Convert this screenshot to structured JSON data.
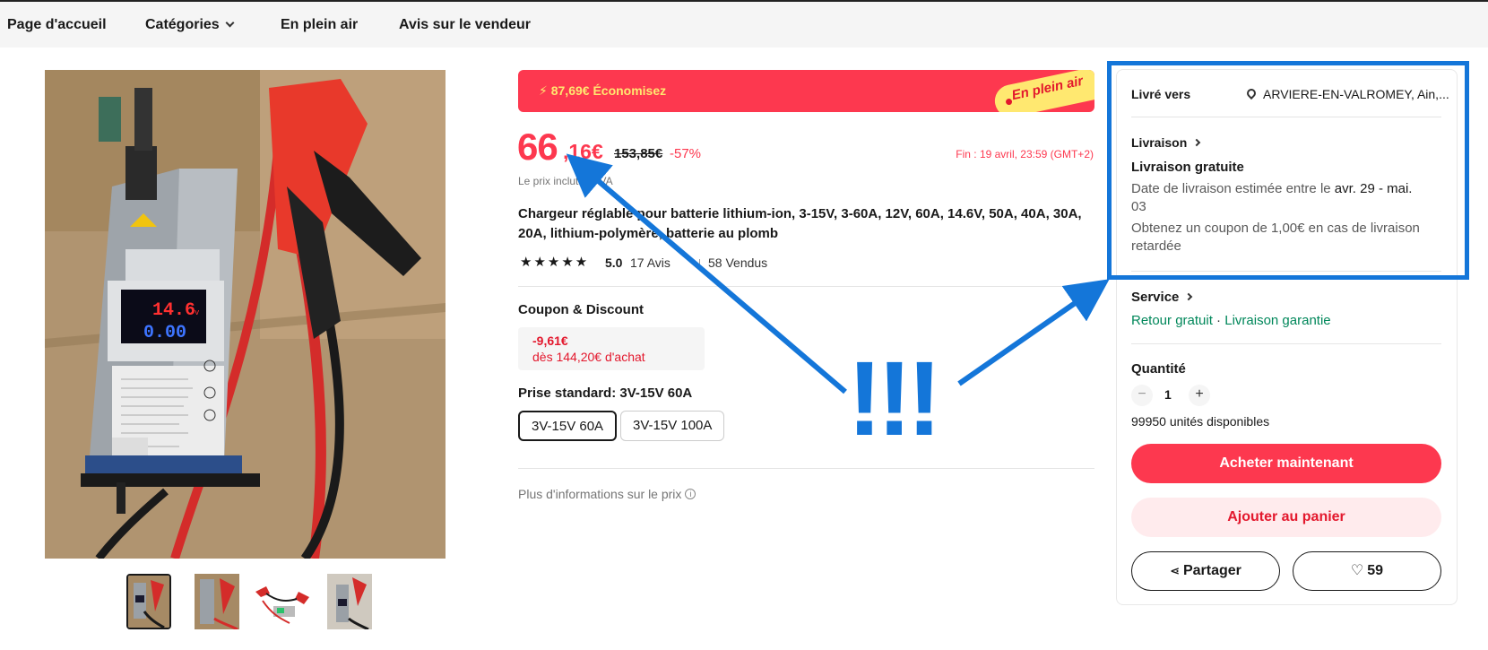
{
  "nav": {
    "home": "Page d'accueil",
    "categories": "Catégories",
    "outdoor": "En plein air",
    "seller_reviews": "Avis sur le vendeur"
  },
  "gallery": {
    "display": {
      "volts": "14.6",
      "volt_unit": "v",
      "amps": "0.00"
    },
    "thumbnails": [
      "thumb-1",
      "thumb-2",
      "thumb-3",
      "thumb-4"
    ]
  },
  "banner": {
    "savings": "87,69€ Économisez",
    "tag": "En plein air",
    "bolt_icon": "lightning-icon"
  },
  "price": {
    "integer": "66",
    "decimals": ",16€",
    "original": "153,85€",
    "discount": "-57%",
    "ends": "Fin : 19 avril, 23:59 (GMT+2)",
    "vat_note": "Le prix inclut la TVA"
  },
  "product": {
    "title": "Chargeur réglable pour batterie lithium-ion, 3-15V, 3-60A, 12V, 60A, 14.6V, 50A, 40A, 30A, 20A, lithium-polymère, batterie au plomb",
    "stars": "★★★★★",
    "rating": "5.0",
    "reviews": "17 Avis",
    "sold": "58 Vendus"
  },
  "coupon": {
    "heading": "Coupon & Discount",
    "amount": "-9,61€",
    "condition": "dès 144,20€ d'achat"
  },
  "plug": {
    "label": "Prise standard: 3V-15V 60A",
    "options": [
      "3V-15V 60A",
      "3V-15V 100A"
    ],
    "selected": "3V-15V 60A"
  },
  "more_info": "Plus d'informations sur le prix",
  "panel": {
    "ship_to_label": "Livré vers",
    "ship_to_value": "ARVIERE-EN-VALROMEY, Ain,...",
    "delivery_label": "Livraison",
    "free_shipping": "Livraison gratuite",
    "estimate_prefix": "Date de livraison estimée entre le ",
    "estimate_dates": "avr. 29 - mai.",
    "estimate_dates_2": "03",
    "late_coupon_1": "Obtenez un coupon de 1,00€ en cas de livraison",
    "late_coupon_2": "retardée",
    "service_label": "Service",
    "service_free_return": "Retour gratuit",
    "service_dot": " · ",
    "service_guarantee": "Livraison garantie",
    "quantity_label": "Quantité",
    "qty_minus": "−",
    "qty_value": "1",
    "qty_plus": "+",
    "stock": "99950 unités disponibles",
    "buy_now": "Acheter maintenant",
    "add_to_cart": "Ajouter au panier",
    "share": "Partager",
    "wishlist_count": "59"
  },
  "annotation": {
    "exclamation": "!!!",
    "color": "#1476d9"
  },
  "colors": {
    "accent_red": "#fd384f",
    "service_green": "#00875a",
    "annotation_blue": "#1476d9"
  }
}
